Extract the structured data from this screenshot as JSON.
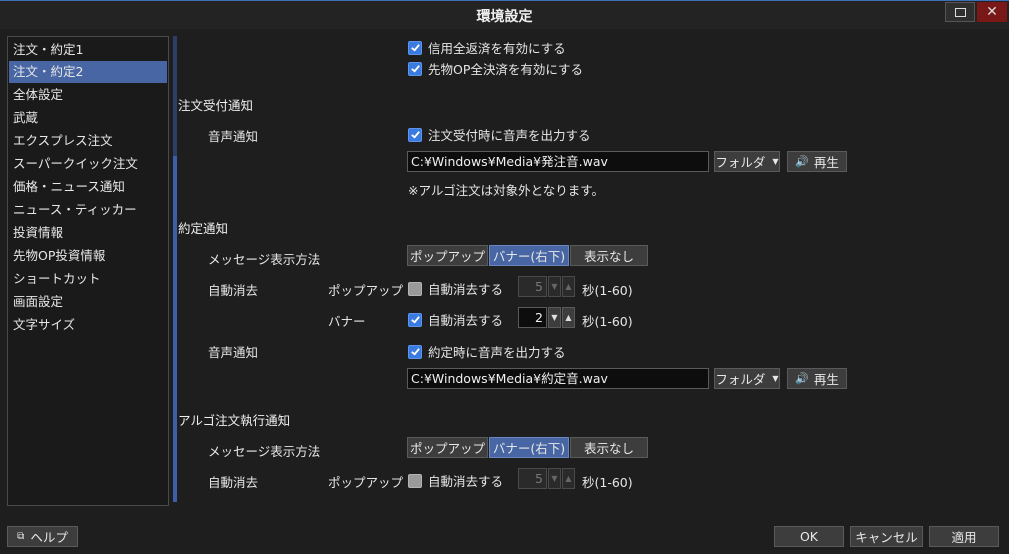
{
  "window": {
    "title": "環境設定"
  },
  "sidebar": {
    "items": [
      {
        "label": "注文・約定1"
      },
      {
        "label": "注文・約定2"
      },
      {
        "label": "全体設定"
      },
      {
        "label": "武蔵"
      },
      {
        "label": "エクスプレス注文"
      },
      {
        "label": "スーパークイック注文"
      },
      {
        "label": "価格・ニュース通知"
      },
      {
        "label": "ニュース・ティッカー"
      },
      {
        "label": "投資情報"
      },
      {
        "label": "先物OP投資情報"
      },
      {
        "label": "ショートカット"
      },
      {
        "label": "画面設定"
      },
      {
        "label": "文字サイズ"
      }
    ],
    "selected": "注文・約定2"
  },
  "top_options": {
    "credit_bulk": {
      "label": "信用全返済を有効にする",
      "checked": true
    },
    "futures_bulk": {
      "label": "先物OP全決済を有効にする",
      "checked": true
    }
  },
  "order_notice": {
    "section_title": "注文受付通知",
    "sound_label": "音声通知",
    "sound_check": {
      "label": "注文受付時に音声を出力する",
      "checked": true
    },
    "path": "C:¥Windows¥Media¥発注音.wav",
    "folder_label": "フォルダ",
    "play_label": "再生",
    "note": "※アルゴ注文は対象外となります。"
  },
  "exec_notice": {
    "section_title": "約定通知",
    "message_label": "メッセージ表示方法",
    "modes": [
      "ポップアップ",
      "バナー(右下)",
      "表示なし"
    ],
    "selected_mode": "バナー(右下)",
    "auto_close_label": "自動消去",
    "popup_label": "ポップアップ",
    "popup_auto": {
      "label": "自動消去する",
      "checked": false,
      "seconds": "5",
      "range": "秒(1-60)"
    },
    "banner_label": "バナー",
    "banner_auto": {
      "label": "自動消去する",
      "checked": true,
      "seconds": "2",
      "range": "秒(1-60)"
    },
    "sound_label": "音声通知",
    "sound_check": {
      "label": "約定時に音声を出力する",
      "checked": true
    },
    "path": "C:¥Windows¥Media¥約定音.wav",
    "folder_label": "フォルダ",
    "play_label": "再生"
  },
  "algo_notice": {
    "section_title": "アルゴ注文執行通知",
    "message_label": "メッセージ表示方法",
    "modes": [
      "ポップアップ",
      "バナー(右下)",
      "表示なし"
    ],
    "selected_mode": "バナー(右下)",
    "auto_close_label": "自動消去",
    "popup_label": "ポップアップ",
    "popup_auto": {
      "label": "自動消去する",
      "checked": false,
      "seconds": "5",
      "range": "秒(1-60)"
    }
  },
  "footer": {
    "help_label": "ヘルプ",
    "ok_label": "OK",
    "cancel_label": "キャンセル",
    "apply_label": "適用"
  },
  "colors": {
    "accent": "#3b7be0",
    "selection": "#4766a3",
    "close_button": "#7a1717"
  }
}
